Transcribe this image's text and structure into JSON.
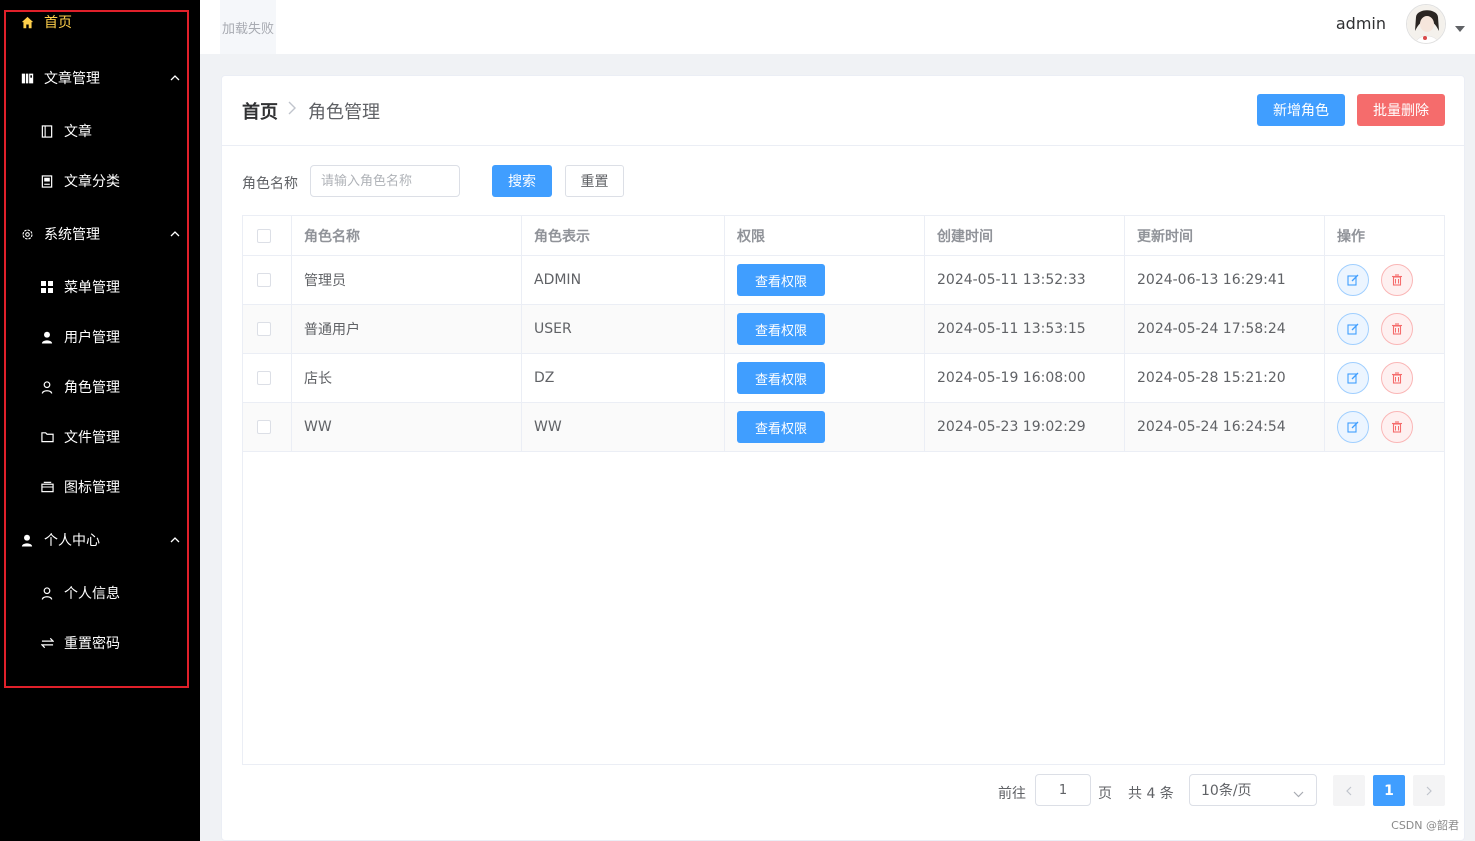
{
  "sidebar": {
    "home": "首页",
    "article_group": "文章管理",
    "article": "文章",
    "article_category": "文章分类",
    "system_group": "系统管理",
    "menu_mgmt": "菜单管理",
    "user_mgmt": "用户管理",
    "role_mgmt": "角色管理",
    "file_mgmt": "文件管理",
    "icon_mgmt": "图标管理",
    "personal_group": "个人中心",
    "personal_info": "个人信息",
    "reset_password": "重置密码"
  },
  "header": {
    "logo_alt": "加载失败",
    "username": "admin"
  },
  "breadcrumb": {
    "home": "首页",
    "current": "角色管理"
  },
  "toolbar": {
    "add_label": "新增角色",
    "batch_delete_label": "批量删除"
  },
  "search": {
    "label": "角色名称",
    "placeholder": "请输入角色名称",
    "search_label": "搜索",
    "reset_label": "重置"
  },
  "table": {
    "headers": [
      "角色名称",
      "角色表示",
      "权限",
      "创建时间",
      "更新时间",
      "操作"
    ],
    "perm_label": "查看权限",
    "rows": [
      {
        "name": "管理员",
        "code": "ADMIN",
        "created": "2024-05-11 13:52:33",
        "updated": "2024-06-13 16:29:41"
      },
      {
        "name": "普通用户",
        "code": "USER",
        "created": "2024-05-11 13:53:15",
        "updated": "2024-05-24 17:58:24"
      },
      {
        "name": "店长",
        "code": "DZ",
        "created": "2024-05-19 16:08:00",
        "updated": "2024-05-28 15:21:20"
      },
      {
        "name": "WW",
        "code": "WW",
        "created": "2024-05-23 19:02:29",
        "updated": "2024-05-24 16:24:54"
      }
    ]
  },
  "pagination": {
    "goto_label": "前往",
    "goto_value": "1",
    "page_unit": "页",
    "total_text": "共 4 条",
    "page_size": "10条/页",
    "current_page": "1"
  },
  "watermark": "CSDN @韶君",
  "colors": {
    "primary": "#409eff",
    "danger": "#f56c6c",
    "sidebar_bg": "#000000",
    "sidebar_active": "#ffd04b",
    "highlight_border": "#e0202a"
  }
}
